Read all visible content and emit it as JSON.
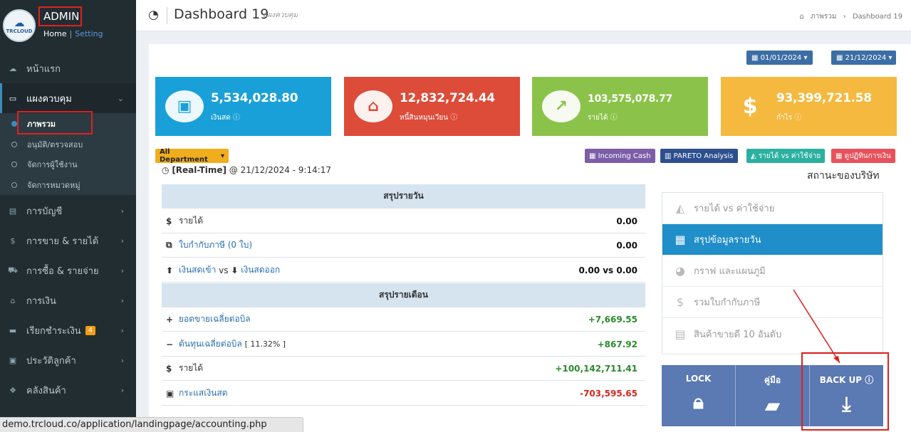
{
  "sidebar": {
    "admin_label": "ADMIN",
    "home_link": "Home",
    "divider": "|",
    "setting_link": "Setting",
    "logo_text": "TRCLOUD",
    "menu": [
      {
        "label": "หน้าแรก",
        "icon": "cloud-icon"
      },
      {
        "label": "แผงควบคุม",
        "icon": "monitor-icon",
        "active": true
      },
      {
        "label": "การบัญชี",
        "icon": "book-icon"
      },
      {
        "label": "การขาย & รายได้",
        "icon": "dollar-icon"
      },
      {
        "label": "การซื้อ & รายจ่าย",
        "icon": "cart-icon"
      },
      {
        "label": "การเงิน",
        "icon": "bank-icon"
      },
      {
        "label": "เรียกชำระเงิน",
        "icon": "credit-card-icon",
        "badge": "4"
      },
      {
        "label": "ประวัติลูกค้า",
        "icon": "contact-icon"
      },
      {
        "label": "คลังสินค้า",
        "icon": "cubes-icon"
      }
    ],
    "submenu": [
      {
        "label": "ภาพรวม",
        "active": true
      },
      {
        "label": "อนุมัติ/ตรวจสอบ"
      },
      {
        "label": "จัดการผู้ใช้งาน"
      },
      {
        "label": "จัดการหมวดหมู่"
      }
    ]
  },
  "header": {
    "title": "Dashboard 19",
    "subtitle": "แผงควบคุม",
    "breadcrumb_home": "ภาพรวม",
    "breadcrumb_current": "Dashboard 19"
  },
  "dates": {
    "from": "01/01/2024",
    "to": "21/12/2024"
  },
  "stats": [
    {
      "value": "5,534,028.80",
      "label": "เงินสด",
      "color": "#1aa0d8",
      "icon": "money-icon"
    },
    {
      "value": "12,832,724.44",
      "label": "หนี้สินหมุนเวียน",
      "color": "#dd4b39",
      "icon": "bank-icon"
    },
    {
      "value": "103,575,078.77",
      "label": "รายได้",
      "color": "#8bc34a",
      "icon": "chart-line-icon"
    },
    {
      "value": "93,399,721.58",
      "label": "กำไร",
      "color": "#f4b93e",
      "icon": "dollar-icon"
    }
  ],
  "department_button": "All Department",
  "tags": [
    {
      "label": "Incoming Cash",
      "color": "#7b5ea7"
    },
    {
      "label": "PARETO Analysis",
      "color": "#2d4f8e"
    },
    {
      "label": "รายได้ vs ค่าใช้จ่าย",
      "color": "#2bb0a0"
    },
    {
      "label": "ดูปฏิทินการเงิน",
      "color": "#e8515b"
    }
  ],
  "realtime": {
    "prefix": "[Real-Time]",
    "at": "@ 21/12/2024 - 9:14:17"
  },
  "daily": {
    "header": "สรุปรายวัน",
    "revenue_label": "รายได้",
    "revenue_value": "0.00",
    "tax_invoice_label": "ใบกำกับภาษี (0 ใบ)",
    "tax_invoice_value": "0.00",
    "cash_in_label": "เงินสดเข้า",
    "vs": "vs",
    "cash_out_label": "เงินสดออก",
    "cash_value": "0.00 vs 0.00"
  },
  "monthly": {
    "header": "สรุปรายเดือน",
    "avg_sales_label": "ยอดขายเฉลี่ยต่อบิล",
    "avg_sales_value": "+7,669.55",
    "avg_cost_label": "ต้นทุนเฉลี่ยต่อบิล",
    "avg_cost_pct": "[ 11.32% ]",
    "avg_cost_value": "+867.92",
    "revenue_label": "รายได้",
    "revenue_value": "+100,142,711.41",
    "cashflow_label": "กระแสเงินสด",
    "cashflow_value": "-703,595.65"
  },
  "company_status": {
    "title": "สถานะของบริษัท",
    "items": [
      {
        "label": "รายได้ vs ค่าใช้จ่าย",
        "icon": "area-chart-icon"
      },
      {
        "label": "สรุปข้อมูลรายวัน",
        "icon": "calendar-plus-icon",
        "active": true
      },
      {
        "label": "กราฟ และแผนภูมิ",
        "icon": "pie-chart-icon"
      },
      {
        "label": "รวมใบกำกับภาษี",
        "icon": "dollar-icon"
      },
      {
        "label": "สินค้าขายดี 10 อันดับ",
        "icon": "newspaper-icon"
      }
    ]
  },
  "actions": {
    "lock": "LOCK",
    "manual": "คู่มือ",
    "backup": "BACK UP"
  },
  "statusbar": {
    "url": "demo.trcloud.co/application/landingpage/accounting.php"
  }
}
